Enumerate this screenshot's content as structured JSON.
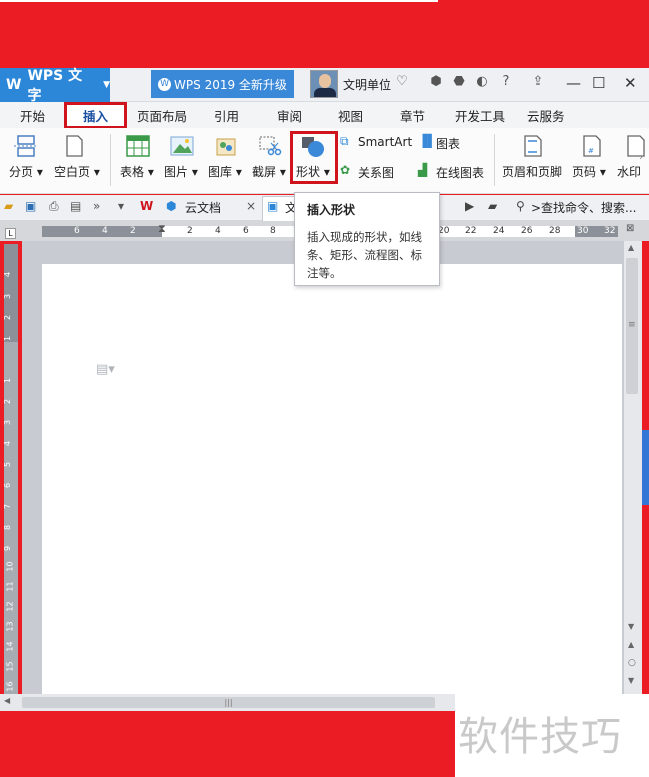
{
  "app": {
    "logo_text": "WPS 文字",
    "upgrade_badge": "WPS 2019 全新升级",
    "user_name": "文明单位"
  },
  "tabs": [
    "开始",
    "插入",
    "页面布局",
    "引用",
    "审阅",
    "视图",
    "章节",
    "开发工具",
    "云服务"
  ],
  "active_tab": "插入",
  "ribbon": {
    "page_break": "分页",
    "blank_page": "空白页",
    "table": "表格",
    "picture": "图片",
    "gallery": "图库",
    "screenshot": "截屏",
    "shape": "形状",
    "smartart": "SmartArt",
    "relation": "关系图",
    "chart": "图表",
    "online_chart": "在线图表",
    "header_footer": "页眉和页脚",
    "page_number": "页码",
    "watermark": "水印"
  },
  "quick_access": {
    "cloud_doc": "云文档",
    "doc_tab": "文",
    "search": ">查找命令、搜索..."
  },
  "ruler": {
    "h_ticks": [
      "6",
      "4",
      "2",
      "2",
      "4",
      "6",
      "8",
      "20",
      "22",
      "24",
      "26",
      "28",
      "30",
      "32"
    ],
    "v_ticks": [
      "4",
      "3",
      "2",
      "1",
      "1",
      "2",
      "3",
      "4",
      "5",
      "6",
      "7",
      "8",
      "9",
      "10",
      "11",
      "12",
      "13",
      "14",
      "15",
      "16"
    ]
  },
  "tooltip": {
    "title": "插入形状",
    "body": "插入现成的形状，如线条、矩形、流程图、标注等。"
  },
  "watermark_text": "软件技巧",
  "colors": {
    "frame_red": "#ec1c24",
    "highlight_red": "#d0141e",
    "wps_blue": "#2d87d8"
  }
}
